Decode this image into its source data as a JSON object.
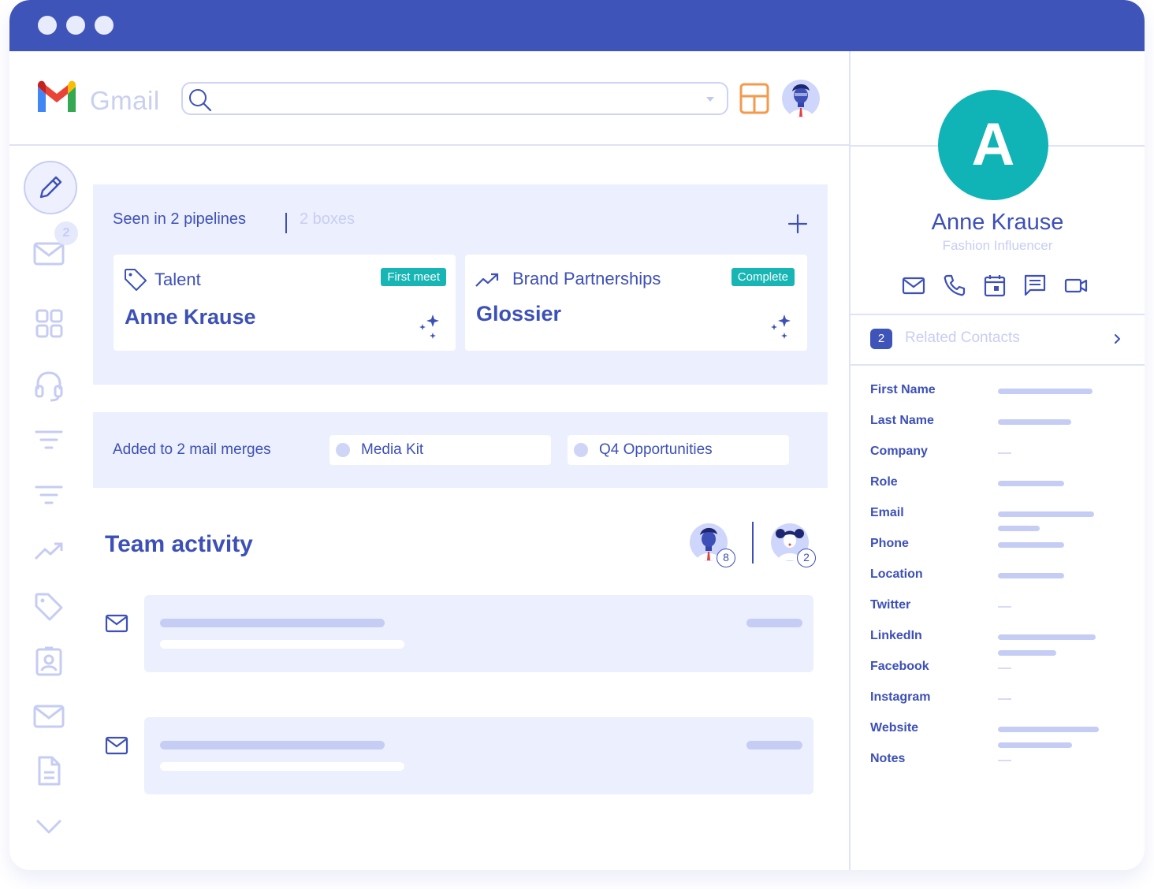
{
  "app": {
    "name": "Gmail",
    "accent": "#3f54b9",
    "teal": "#10b3b6"
  },
  "header": {
    "search_placeholder": "",
    "icons": [
      "search-icon",
      "chevron-down-icon",
      "layout-icon",
      "user-avatar"
    ]
  },
  "sidebar": {
    "mail_badge": "2",
    "icons": [
      "pencil-icon",
      "mail-icon",
      "grid-icon",
      "headset-icon",
      "filter-icon",
      "filter-icon",
      "trend-icon",
      "tag-icon",
      "contact-card-icon",
      "mail-icon",
      "document-icon",
      "chevron-down-icon"
    ]
  },
  "pipelines": {
    "title": "Seen in 2 pipelines",
    "boxes": "2 boxes",
    "cards": [
      {
        "label": "Talent",
        "badge": "First meet",
        "title": "Anne Krause",
        "icon": "tag-icon"
      },
      {
        "label": "Brand Partnerships",
        "badge": "Complete",
        "title": "Glossier",
        "icon": "trend-icon"
      }
    ]
  },
  "merges": {
    "title": "Added to 2 mail merges",
    "items": [
      "Media Kit",
      "Q4 Opportunities"
    ]
  },
  "team": {
    "title": "Team activity",
    "members": [
      {
        "count": "8"
      },
      {
        "count": "2"
      }
    ]
  },
  "contact": {
    "initial": "A",
    "name": "Anne Krause",
    "role": "Fashion Influencer",
    "actions": [
      "mail-icon",
      "phone-icon",
      "calendar-icon",
      "chat-icon",
      "video-icon"
    ],
    "related_count": "2",
    "related_label": "Related Contacts",
    "fields": [
      {
        "label": "First Name",
        "filled": true
      },
      {
        "label": "Last Name",
        "filled": true
      },
      {
        "label": "Company",
        "filled": false
      },
      {
        "label": "Role",
        "filled": true
      },
      {
        "label": "Email",
        "filled": true
      },
      {
        "label": "Phone",
        "filled": true
      },
      {
        "label": "Location",
        "filled": true
      },
      {
        "label": "Twitter",
        "filled": false
      },
      {
        "label": "LinkedIn",
        "filled": true
      },
      {
        "label": "Facebook",
        "filled": false
      },
      {
        "label": "Instagram",
        "filled": false
      },
      {
        "label": "Website",
        "filled": true
      },
      {
        "label": "Notes",
        "filled": false
      }
    ]
  }
}
